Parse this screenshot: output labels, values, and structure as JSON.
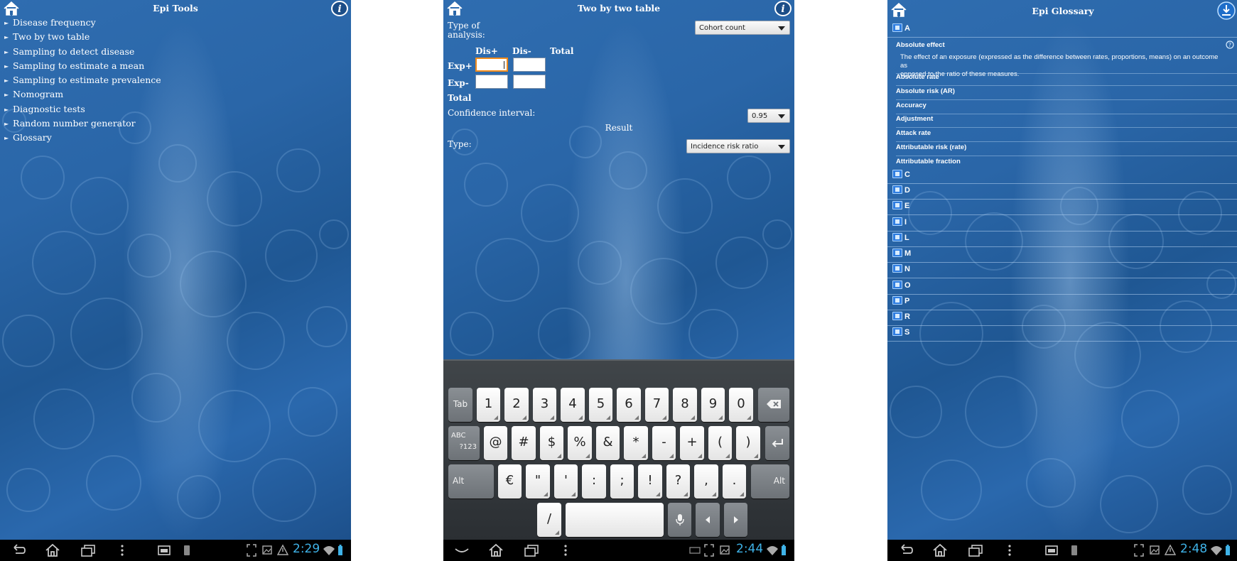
{
  "screen1": {
    "title": "Epi Tools",
    "menu": [
      "Disease frequency",
      "Two by two table",
      "Sampling to detect disease",
      "Sampling to estimate a mean",
      "Sampling to estimate prevalence",
      "Nomogram",
      "Diagnostic tests",
      "Random number generator",
      "Glossary"
    ],
    "clock": "2:29"
  },
  "screen2": {
    "title": "Two by two table",
    "analysis_label_1": "Type of",
    "analysis_label_2": "analysis:",
    "analysis_value": "Cohort count",
    "col_dis_pos": "Dis+",
    "col_dis_neg": "Dis-",
    "col_total": "Total",
    "row_exp_pos": "Exp+",
    "row_exp_neg": "Exp-",
    "row_total": "Total",
    "ci_label": "Confidence interval:",
    "ci_value": "0.95",
    "result_label": "Result",
    "type_label": "Type:",
    "type_value": "Incidence risk ratio",
    "keyboard": {
      "row1": [
        "Tab",
        "1",
        "2",
        "3",
        "4",
        "5",
        "6",
        "7",
        "8",
        "9",
        "0"
      ],
      "row2": [
        "@",
        "#",
        "$",
        "%",
        "&",
        "*",
        "-",
        "+",
        "(",
        ")"
      ],
      "row3": [
        "€",
        "\"",
        "'",
        ":",
        ";",
        "!",
        "?",
        ",",
        "."
      ],
      "row4": [
        "/"
      ],
      "abc": "ABC",
      "q123": "?123",
      "alt": "Alt"
    },
    "clock": "2:44"
  },
  "screen3": {
    "title": "Epi Glossary",
    "letter_a": "A",
    "terms": [
      "Absolute effect",
      "Absolute rate",
      "Absolute risk (AR)",
      "Accuracy",
      "Adjustment",
      "Attack rate",
      "Attributable risk (rate)",
      "Attributable fraction"
    ],
    "definition_1": "The effect of an exposure (expressed as the difference between rates, proportions, means) on an outcome as",
    "definition_2": "opposed to the ratio of these measures.",
    "letters": [
      "C",
      "D",
      "E",
      "I",
      "L",
      "M",
      "N",
      "O",
      "P",
      "R",
      "S"
    ],
    "clock": "2:48"
  },
  "colors": {
    "background_blue": "#2a66a8",
    "clock_blue": "#3fb3e8",
    "focus_orange": "#f08a1a",
    "navbar": "#000000"
  }
}
